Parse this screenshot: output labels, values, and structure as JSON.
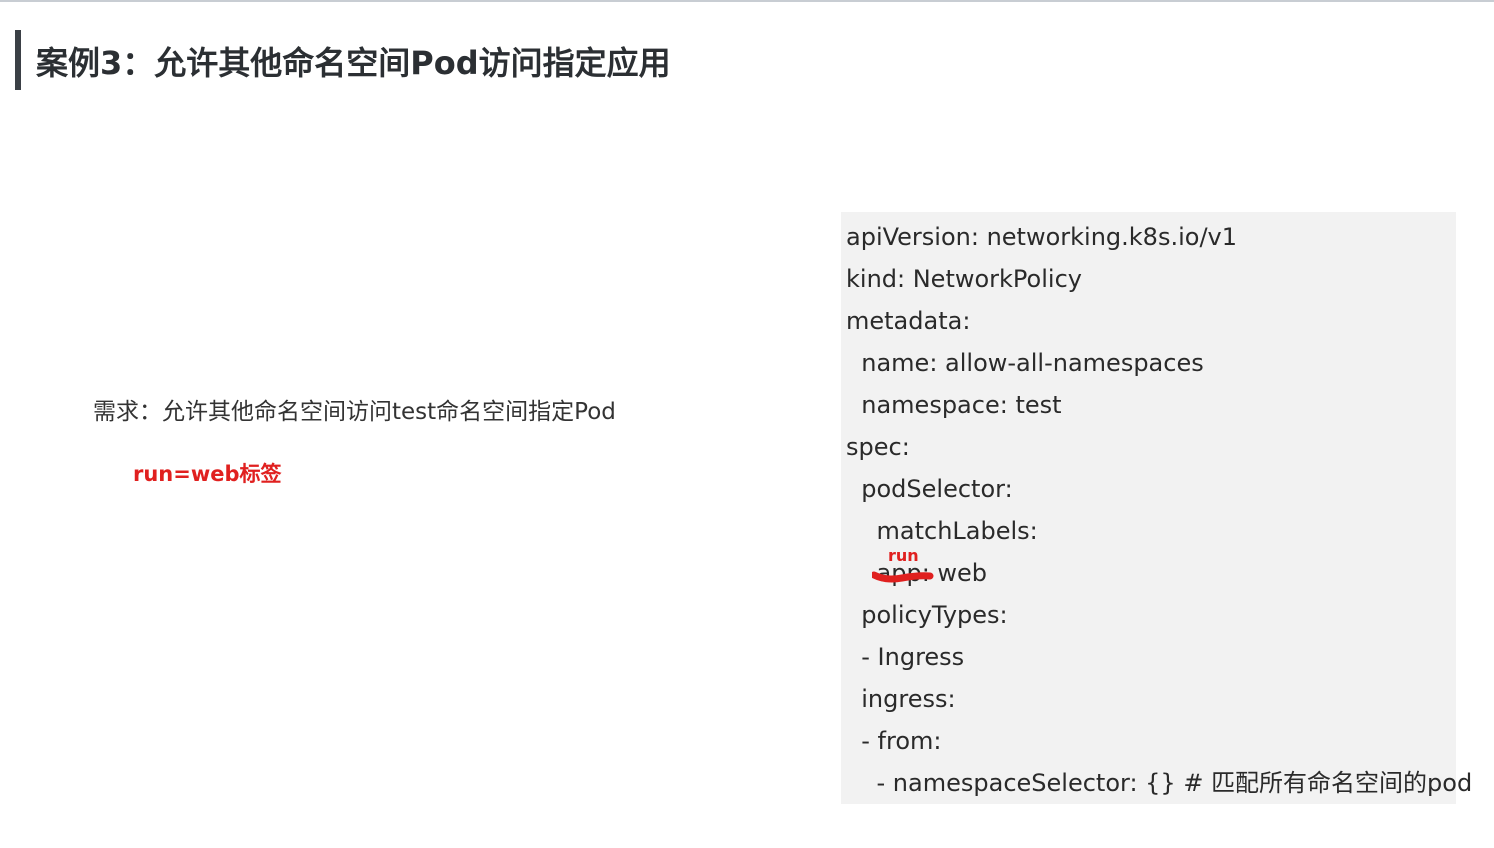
{
  "slide": {
    "title": "案例3：允许其他命名空间Pod访问指定应用",
    "requirement": "需求：允许其他命名空间访问test命名空间指定Pod",
    "label_note": "run=web标签"
  },
  "code": {
    "lines": [
      "apiVersion: networking.k8s.io/v1",
      "kind: NetworkPolicy",
      "metadata:",
      "  name: allow-all-namespaces",
      "  namespace: test",
      "spec:",
      "  podSelector:",
      "    matchLabels:",
      "    app: web",
      "  policyTypes:",
      "  - Ingress",
      "  ingress:",
      "  - from:",
      "    - namespaceSelector: {} # 匹配所有命名空间的pod"
    ],
    "annotation": "run"
  },
  "colors": {
    "accent_red": "#e0201f",
    "code_bg": "#f2f2f2",
    "title_bar": "#3b4046"
  }
}
